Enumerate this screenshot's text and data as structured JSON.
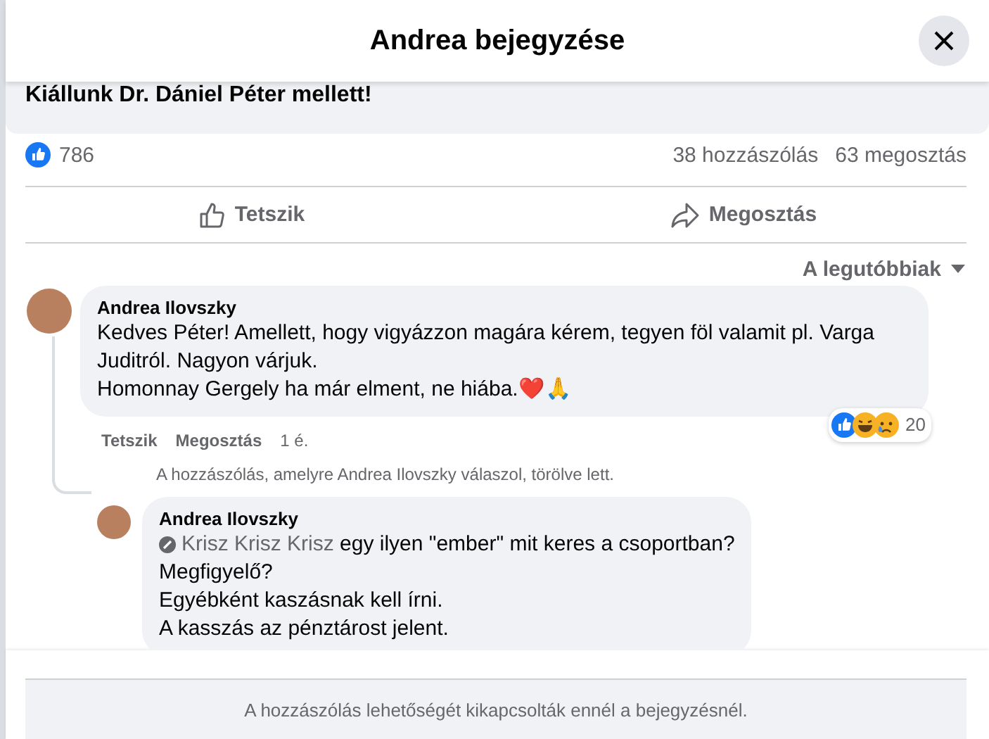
{
  "dialog": {
    "title": "Andrea bejegyzése"
  },
  "post": {
    "text": "Kiállunk Dr. Dániel Péter mellett!",
    "like_count": "786",
    "comment_count": "38 hozzászólás",
    "share_count": "63 megosztás",
    "actions": [
      "Tetszik",
      "Megosztás"
    ]
  },
  "sort": {
    "label": "A legutóbbiak"
  },
  "comments": [
    {
      "author": "Andrea Ilovszky",
      "paragraphs": [
        "Kedves Péter! Amellett, hogy vigyázzon magára kérem, tegyen föl valamit pl. Varga Juditról. Nagyon várjuk.",
        "Homonnay Gergely ha már elment, ne hiába.❤️🙏"
      ],
      "reaction_count": "20",
      "actions": [
        "Tetszik",
        "Megosztás"
      ],
      "time": "1 é.",
      "reply_notice": "A hozzászólás, amelyre Andrea Ilovszky válaszol, törölve lett.",
      "replies": [
        {
          "author": "Andrea Ilovszky",
          "mention": "Krisz Krisz Krisz",
          "paragraphs": [
            "egy ilyen \"ember\" mit keres a csoportban?",
            "Megfigyelő?",
            "Egyébként kaszásnak kell írni.",
            "A kasszás az pénztárost jelent."
          ]
        }
      ]
    }
  ],
  "footer": {
    "notice": "A hozzászólás lehetőségét kikapcsolták ennél a bejegyzésnél."
  }
}
